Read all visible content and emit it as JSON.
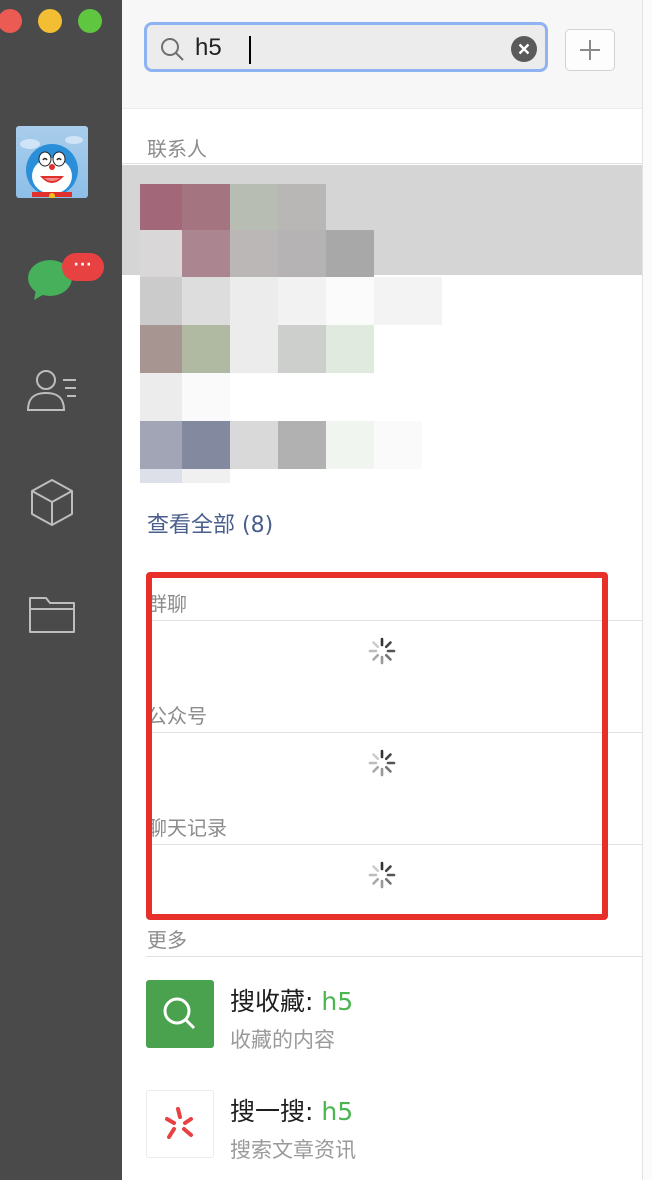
{
  "window": {
    "traffic_lights": [
      "close",
      "minimize",
      "zoom"
    ]
  },
  "sidebar": {
    "chat_badge": "···",
    "items": [
      {
        "name": "chat-icon"
      },
      {
        "name": "contacts-icon"
      },
      {
        "name": "miniprogram-box-icon"
      },
      {
        "name": "folder-icon"
      }
    ]
  },
  "search": {
    "value": "h5"
  },
  "sections": {
    "contacts": "联系人",
    "view_all": "查看全部 (8)",
    "group_chats": "群聊",
    "official_accounts": "公众号",
    "chat_history": "聊天记录",
    "more": "更多"
  },
  "more_items": [
    {
      "title": "搜收藏: ",
      "keyword": "h5",
      "subtitle": "收藏的内容",
      "icon": "search-favorites-icon",
      "color": "#4aa24f"
    },
    {
      "title": "搜一搜: ",
      "keyword": "h5",
      "subtitle": "搜索文章资讯",
      "icon": "sou-yi-sou-icon",
      "color": "#e84141"
    }
  ],
  "colors": {
    "sidebar": "#4a4a4a",
    "highlight_frame": "#e8302b",
    "keyword": "#4bb552",
    "link": "#4a5f8c"
  }
}
